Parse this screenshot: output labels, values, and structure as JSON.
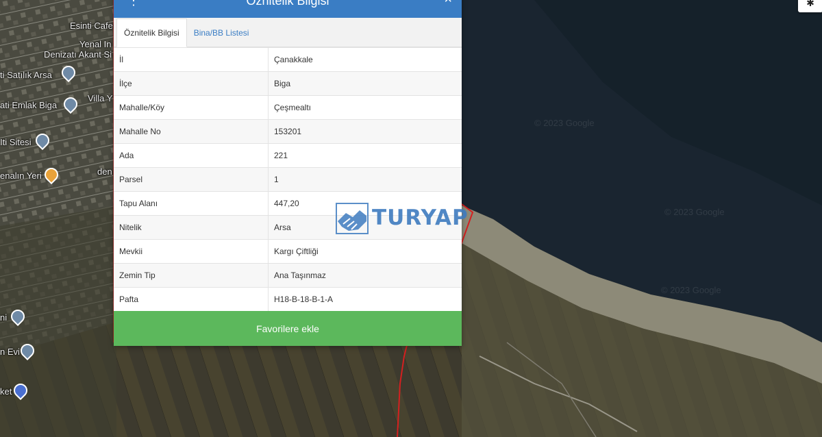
{
  "popup": {
    "title": "Öznitelik Bilgisi",
    "tabs": [
      {
        "label": "Öznitelik Bilgisi",
        "active": true
      },
      {
        "label": "Bina/BB Listesi",
        "active": false
      }
    ],
    "rows": [
      {
        "key": "İl",
        "value": "Çanakkale"
      },
      {
        "key": "İlçe",
        "value": "Biga"
      },
      {
        "key": "Mahalle/Köy",
        "value": "Çeşmealtı"
      },
      {
        "key": "Mahalle No",
        "value": "153201"
      },
      {
        "key": "Ada",
        "value": "221"
      },
      {
        "key": "Parsel",
        "value": "1"
      },
      {
        "key": "Tapu Alanı",
        "value": "447,20"
      },
      {
        "key": "Nitelik",
        "value": "Arsa"
      },
      {
        "key": "Mevkii",
        "value": "Kargı Çiftliği"
      },
      {
        "key": "Zemin Tip",
        "value": "Ana Taşınmaz"
      },
      {
        "key": "Pafta",
        "value": "H18-B-18-B-1-A"
      }
    ],
    "favorite_button": "Favorilere ekle"
  },
  "logo": {
    "text": "TURYAP"
  },
  "map": {
    "labels": [
      "Esinti Cafe",
      "Yenal In",
      "Denizatı Akant Si",
      "ti Satılık Arsa",
      "Villa Y",
      "ati Emlak Biga",
      "Iti Sitesi",
      "den",
      "enalın Yeri",
      "ni",
      "n Evi",
      "ket"
    ],
    "watermarks": [
      "© 2023 Google",
      "© 2023 Google",
      "© 2023 Google"
    ]
  },
  "colors": {
    "header": "#3a7dc4",
    "favorite": "#5cb85c",
    "parcel_border": "#d42020"
  }
}
